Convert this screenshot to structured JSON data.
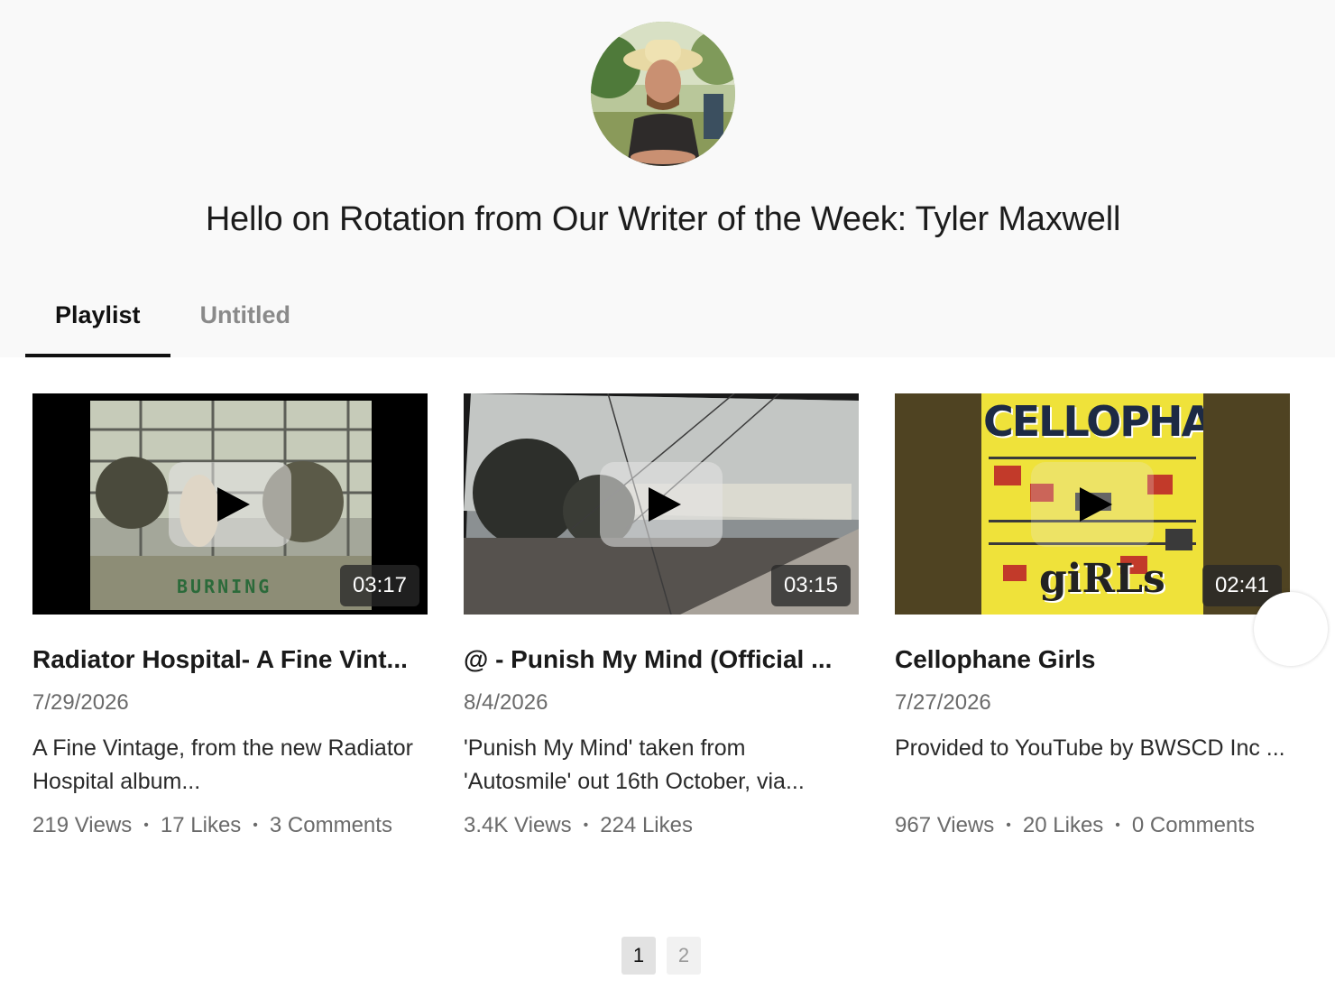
{
  "header": {
    "title": "Hello on Rotation from Our Writer of the Week: Tyler Maxwell",
    "avatar_icon": "profile-photo"
  },
  "tabs": [
    {
      "label": "Playlist",
      "active": true
    },
    {
      "label": "Untitled",
      "active": false
    }
  ],
  "videos": [
    {
      "title": "Radiator Hospital- A Fine Vint...",
      "date": "7/29/2026",
      "description": "A Fine Vintage, from the new Radiator Hospital album...",
      "duration": "03:17",
      "views": "219 Views",
      "likes": "17 Likes",
      "comments": "3 Comments",
      "thumb_text": "BURNING"
    },
    {
      "title": "@ - Punish My Mind (Official ...",
      "date": "8/4/2026",
      "description": "'Punish My Mind' taken from 'Autosmile' out 16th October, via...",
      "duration": "03:15",
      "views": "3.4K Views",
      "likes": "224 Likes",
      "comments": ""
    },
    {
      "title": "Cellophane Girls",
      "date": "7/27/2026",
      "description": "Provided to YouTube by BWSCD Inc ...",
      "duration": "02:41",
      "views": "967 Views",
      "likes": "20 Likes",
      "comments": "0 Comments",
      "thumb_text_top": "CELLOPHANE",
      "thumb_text_bottom": "giRLs"
    }
  ],
  "pagination": {
    "pages": [
      "1",
      "2"
    ],
    "current": "1"
  }
}
